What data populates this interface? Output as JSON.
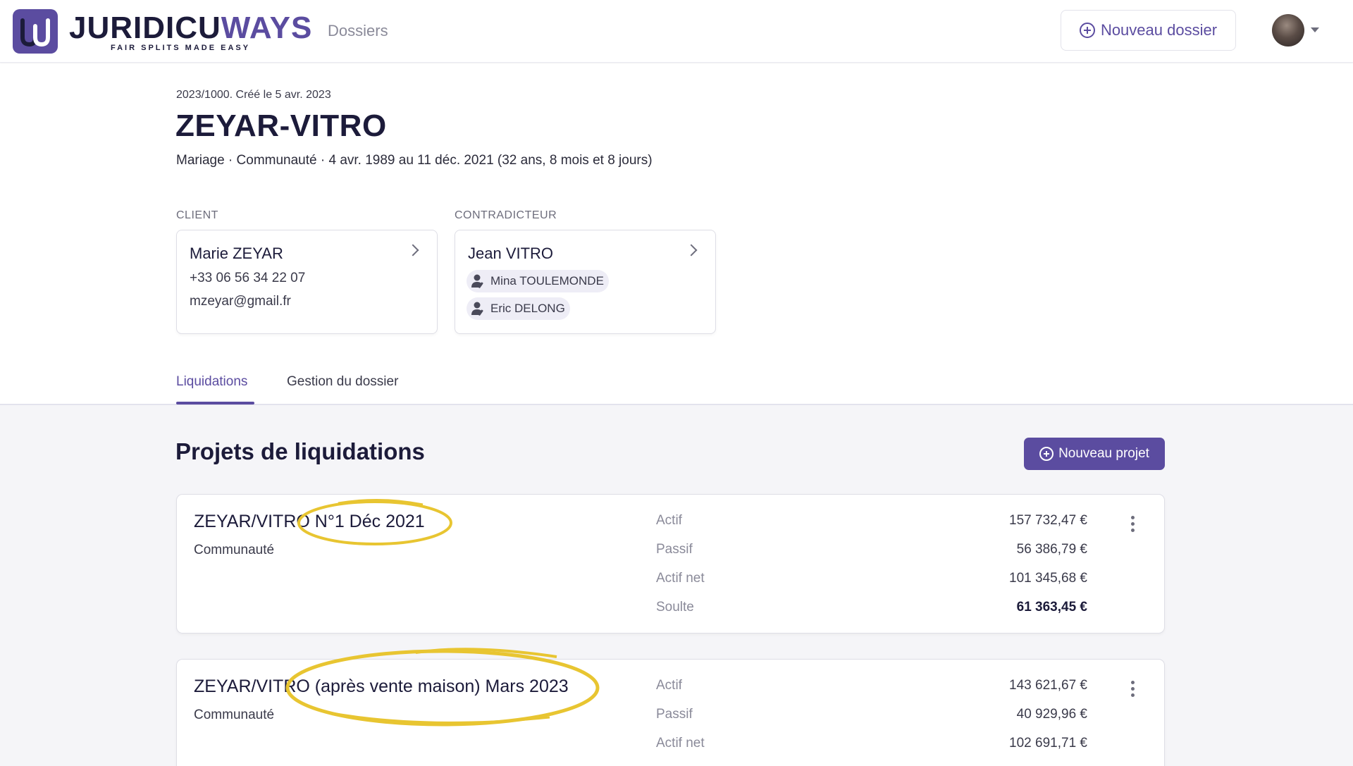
{
  "header": {
    "logo_text_main": "JURIDICU",
    "logo_text_accent": "WAYS",
    "tagline": "FAIR SPLITS MADE EASY",
    "nav_dossiers": "Dossiers",
    "new_dossier_label": "Nouveau dossier"
  },
  "dossier": {
    "meta": "2023/1000. Créé le 5 avr. 2023",
    "title": "ZEYAR-VITRO",
    "subtitle": "Mariage · Communauté · 4 avr. 1989 au 11 déc. 2021 (32 ans, 8 mois et 8 jours)"
  },
  "client": {
    "label": "CLIENT",
    "name": "Marie ZEYAR",
    "phone": "+33 06 56 34 22 07",
    "email": "mzeyar@gmail.fr"
  },
  "contradicteur": {
    "label": "CONTRADICTEUR",
    "name": "Jean VITRO",
    "lawyers": [
      "Mina TOULEMONDE",
      "Eric DELONG"
    ]
  },
  "tabs": [
    {
      "label": "Liquidations",
      "active": true
    },
    {
      "label": "Gestion du dossier",
      "active": false
    }
  ],
  "projects_section": {
    "title": "Projets de liquidations",
    "new_project_label": "Nouveau projet"
  },
  "projects": [
    {
      "name": "ZEYAR/VITRO N°1 Déc 2021",
      "regime": "Communauté",
      "rows": [
        {
          "label": "Actif",
          "value": "157 732,47 €"
        },
        {
          "label": "Passif",
          "value": "56 386,79 €"
        },
        {
          "label": "Actif net",
          "value": "101 345,68 €"
        },
        {
          "label": "Soulte",
          "value": "61 363,45 €"
        }
      ]
    },
    {
      "name": "ZEYAR/VITRO (après vente maison) Mars 2023",
      "regime": "Communauté",
      "rows": [
        {
          "label": "Actif",
          "value": "143 621,67 €"
        },
        {
          "label": "Passif",
          "value": "40 929,96 €"
        },
        {
          "label": "Actif net",
          "value": "102 691,71 €"
        }
      ]
    }
  ],
  "colors": {
    "brand": "#5b4ca0",
    "text_dark": "#1c1b3a",
    "highlight_marker": "#e8c531",
    "page_background": "#f5f5f8"
  }
}
